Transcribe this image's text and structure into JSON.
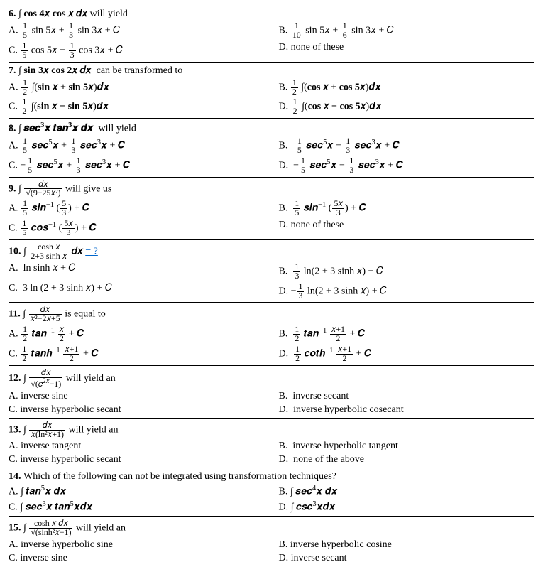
{
  "questions": [
    {
      "num": "6.",
      "stem_html": "∫ cos 4𝑥 cos 𝑥 𝑑𝑥 <span>will yield</span>",
      "opts": [
        "A. <span class='frac'><span class='n'>1</span><span class='d'>5</span></span> sin 5𝑥 + <span class='frac'><span class='n'>1</span><span class='d'>3</span></span> sin 3𝑥 + 𝐶",
        "B. <span class='frac'><span class='n'>1</span><span class='d'>10</span></span> sin 5𝑥 + <span class='frac'><span class='n'>1</span><span class='d'>6</span></span> sin 3𝑥 + 𝐶",
        "C. <span class='frac'><span class='n'>1</span><span class='d'>5</span></span> cos 5𝑥 − <span class='frac'><span class='n'>1</span><span class='d'>3</span></span> cos 3𝑥 + 𝐶",
        "D. none of these"
      ]
    },
    {
      "num": "7.",
      "stem_html": "∫ sin 3𝑥 cos 2𝑥 𝑑𝑥 &nbsp;<span>can be transformed to</span>",
      "opts": [
        "A. <span class='frac'><span class='n'>1</span><span class='d'>2</span></span> ∫(<span class='bold'>sin 𝑥 + sin 5𝑥</span>)𝒅𝒙",
        "B. <span class='frac'><span class='n'>1</span><span class='d'>2</span></span> ∫(<span class='bold'>cos 𝑥 + cos 5𝑥</span>)𝒅𝒙",
        "C. <span class='frac'><span class='n'>1</span><span class='d'>2</span></span> ∫(<span class='bold'>sin 𝑥 − sin 5𝑥</span>)𝒅𝒙",
        "D. <span class='frac'><span class='n'>1</span><span class='d'>2</span></span> ∫(<span class='bold'>cos 𝑥 − cos 5𝑥</span>)𝒅𝒙"
      ]
    },
    {
      "num": "8.",
      "stem_html": "∫ 𝒔𝒆𝒄<sup>3</sup>𝒙 𝒕𝒂𝒏<sup>3</sup>𝒙 𝒅𝒙 &nbsp;<span>will yield</span>",
      "opts": [
        "A. <span class='frac'><span class='n'>1</span><span class='d'>5</span></span> 𝒔𝒆𝒄<sup>5</sup>𝒙 + <span class='frac'><span class='n'>1</span><span class='d'>3</span></span> 𝒔𝒆𝒄<sup>3</sup>𝒙 + 𝑪",
        "B. &nbsp;&nbsp;<span class='frac'><span class='n'>1</span><span class='d'>5</span></span> 𝒔𝒆𝒄<sup>5</sup>𝒙 − <span class='frac'><span class='n'>1</span><span class='d'>3</span></span> 𝒔𝒆𝒄<sup>3</sup>𝒙 + 𝑪",
        "C. −<span class='frac'><span class='n'>1</span><span class='d'>5</span></span> 𝒔𝒆𝒄<sup>5</sup>𝒙 + <span class='frac'><span class='n'>1</span><span class='d'>3</span></span> 𝒔𝒆𝒄<sup>3</sup>𝒙 + 𝑪",
        "D. &nbsp;−<span class='frac'><span class='n'>1</span><span class='d'>5</span></span> 𝒔𝒆𝒄<sup>5</sup>𝒙 − <span class='frac'><span class='n'>1</span><span class='d'>3</span></span> 𝒔𝒆𝒄<sup>3</sup>𝒙 + 𝑪"
      ]
    },
    {
      "num": "9.",
      "stem_html": "∫ <span class='frac'><span class='n'>𝑑𝑥</span><span class='d'>√(9−25𝑥²)</span></span> <span>will give us</span>",
      "opts": [
        "A. <span class='frac'><span class='n'>1</span><span class='d'>5</span></span> 𝒔𝒊𝒏<sup>−1</sup> (<span class='frac'><span class='n'>5</span><span class='d'>3</span></span>) + 𝑪",
        "B. &nbsp;<span class='frac'><span class='n'>1</span><span class='d'>5</span></span> 𝒔𝒊𝒏<sup>−1</sup> (<span class='frac'><span class='n'>5𝑥</span><span class='d'>3</span></span>) + 𝑪",
        "C. <span class='frac'><span class='n'>1</span><span class='d'>5</span></span> 𝒄𝒐𝒔<sup>−1</sup> (<span class='frac'><span class='n'>5𝑥</span><span class='d'>3</span></span>) + 𝑪",
        "D. none of these"
      ]
    },
    {
      "num": "10.",
      "stem_html": "∫ <span class='frac'><span class='n'>cosh 𝑥</span><span class='d'>2+3 sinh 𝑥</span></span> 𝑑𝑥 <span class='link'>= ?</span>",
      "opts": [
        "A. &nbsp;ln sinh 𝑥 + 𝐶",
        "B. &nbsp;<span class='frac'><span class='n'>1</span><span class='d'>3</span></span> ln(2 + 3 sinh 𝑥) + 𝐶",
        "C. &nbsp;3 ln (2 + 3 sinh 𝑥) + 𝐶",
        "D. −<span class='frac'><span class='n'>1</span><span class='d'>3</span></span> ln(2 + 3 sinh 𝑥) + 𝐶"
      ]
    },
    {
      "num": "11.",
      "stem_html": "∫ <span class='frac'><span class='n'>𝑑𝑥</span><span class='d'>𝑥²−2𝑥+5</span></span> <span>is equal to</span>",
      "opts": [
        "A. <span class='frac'><span class='n'>1</span><span class='d'>2</span></span> 𝒕𝒂𝒏<sup>−1</sup> <span class='frac'><span class='n'>𝑥</span><span class='d'>2</span></span> + 𝑪",
        "B. &nbsp;<span class='frac'><span class='n'>1</span><span class='d'>2</span></span> 𝒕𝒂𝒏<sup>−1</sup> <span class='frac'><span class='n'>𝑥+1</span><span class='d'>2</span></span> + 𝑪",
        "C. <span class='frac'><span class='n'>1</span><span class='d'>2</span></span> 𝒕𝒂𝒏𝒉<sup>−1</sup> <span class='frac'><span class='n'>𝑥+1</span><span class='d'>2</span></span> + 𝑪",
        "D. &nbsp;<span class='frac'><span class='n'>1</span><span class='d'>2</span></span> 𝒄𝒐𝒕𝒉<sup>−1</sup> <span class='frac'><span class='n'>𝑥+1</span><span class='d'>2</span></span> + 𝑪"
      ]
    },
    {
      "num": "12.",
      "stem_html": "∫ <span class='frac'><span class='n'>𝑑𝑥</span><span class='d'>√(𝑒<sup>2𝑥</sup>−1)</span></span> <span>will yield an</span>",
      "opts": [
        "A. inverse sine",
        "B. &nbsp;inverse secant",
        "C. inverse hyperbolic secant",
        "D. &nbsp;inverse hyperbolic cosecant"
      ]
    },
    {
      "num": "13.",
      "stem_html": "∫ <span class='frac'><span class='n'>𝑑𝑥</span><span class='d'>𝑥(ln²𝑥+1)</span></span> <span>will yield an</span>",
      "opts": [
        "A. inverse tangent",
        "B. &nbsp;inverse hyperbolic tangent",
        "C. inverse hyperbolic secant",
        "D. &nbsp;none of the above"
      ]
    },
    {
      "num": "14.",
      "stem_html": "<span>Which of the following can not be integrated using transformation techniques?</span>",
      "opts": [
        "A. ∫ 𝒕𝒂𝒏<sup>5</sup>𝒙 𝒅𝒙",
        "B. ∫ 𝒔𝒆𝒄<sup>4</sup>𝒙 𝒅𝒙",
        "C. ∫ 𝒔𝒆𝒄<sup>3</sup>𝒙 𝒕𝒂𝒏<sup>5</sup>𝒙𝒅𝒙",
        "D. ∫ 𝒄𝒔𝒄<sup>3</sup>𝒙𝒅𝒙"
      ]
    },
    {
      "num": "15.",
      "stem_html": "∫ <span class='frac'><span class='n'>cosh 𝑥 𝑑𝑥</span><span class='d'>√(sinh²𝑥−1)</span></span> <span>will yield an</span>",
      "opts": [
        "A. inverse hyperbolic sine",
        "B. inverse hyperbolic cosine",
        "C. inverse sine",
        "D. inverse secant"
      ]
    }
  ]
}
